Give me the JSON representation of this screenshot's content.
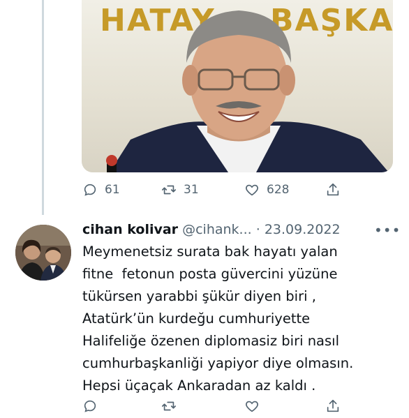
{
  "media": {
    "banner_left": "HATAY",
    "banner_right": "BAŞKA"
  },
  "tweet1": {
    "replies": "61",
    "retweets": "31",
    "likes": "628"
  },
  "tweet2": {
    "display_name": "cihan kolivar",
    "handle": "@cihank...",
    "separator": "·",
    "date": "23.09.2022",
    "more": "•••",
    "lines": [
      "Meymenetsiz surata bak hayatı yalan",
      "fitne  fetonun posta güvercini yüzüne",
      "tükürsen yarabbi şükür diyen biri ,",
      "Atatürk’ün kurdeğu cumhuriyette",
      "Halifeliğe özenen diplomasiz biri nasıl",
      "cumhurbaşkanliği yapiyor diye olmasın.",
      "Hepsi üçaçak Ankaradan az kaldı ."
    ]
  },
  "icons": [
    "reply-icon",
    "retweet-icon",
    "like-icon",
    "share-icon"
  ]
}
